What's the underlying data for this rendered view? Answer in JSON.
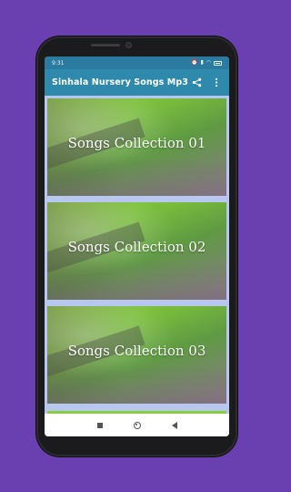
{
  "status_bar": {
    "time": "9:31",
    "icons": [
      "alarm-icon",
      "signal-icon",
      "wifi-icon",
      "battery-icon"
    ]
  },
  "app_bar": {
    "title": "Sinhala Nursery Songs Mp3",
    "actions": [
      "share-icon",
      "more-vert-icon"
    ]
  },
  "collections": [
    {
      "label": "Songs Collection 01"
    },
    {
      "label": "Songs Collection 02"
    },
    {
      "label": "Songs Collection 03"
    }
  ],
  "nav_bar": {
    "buttons": [
      "recent-apps-icon",
      "home-icon",
      "back-icon"
    ]
  },
  "colors": {
    "background": "#6a3fb0",
    "app_bar": "#2e89ad",
    "status_bar": "#2b7a9f",
    "list_background": "#b8c7f0",
    "card_green": "#8bd13e"
  }
}
